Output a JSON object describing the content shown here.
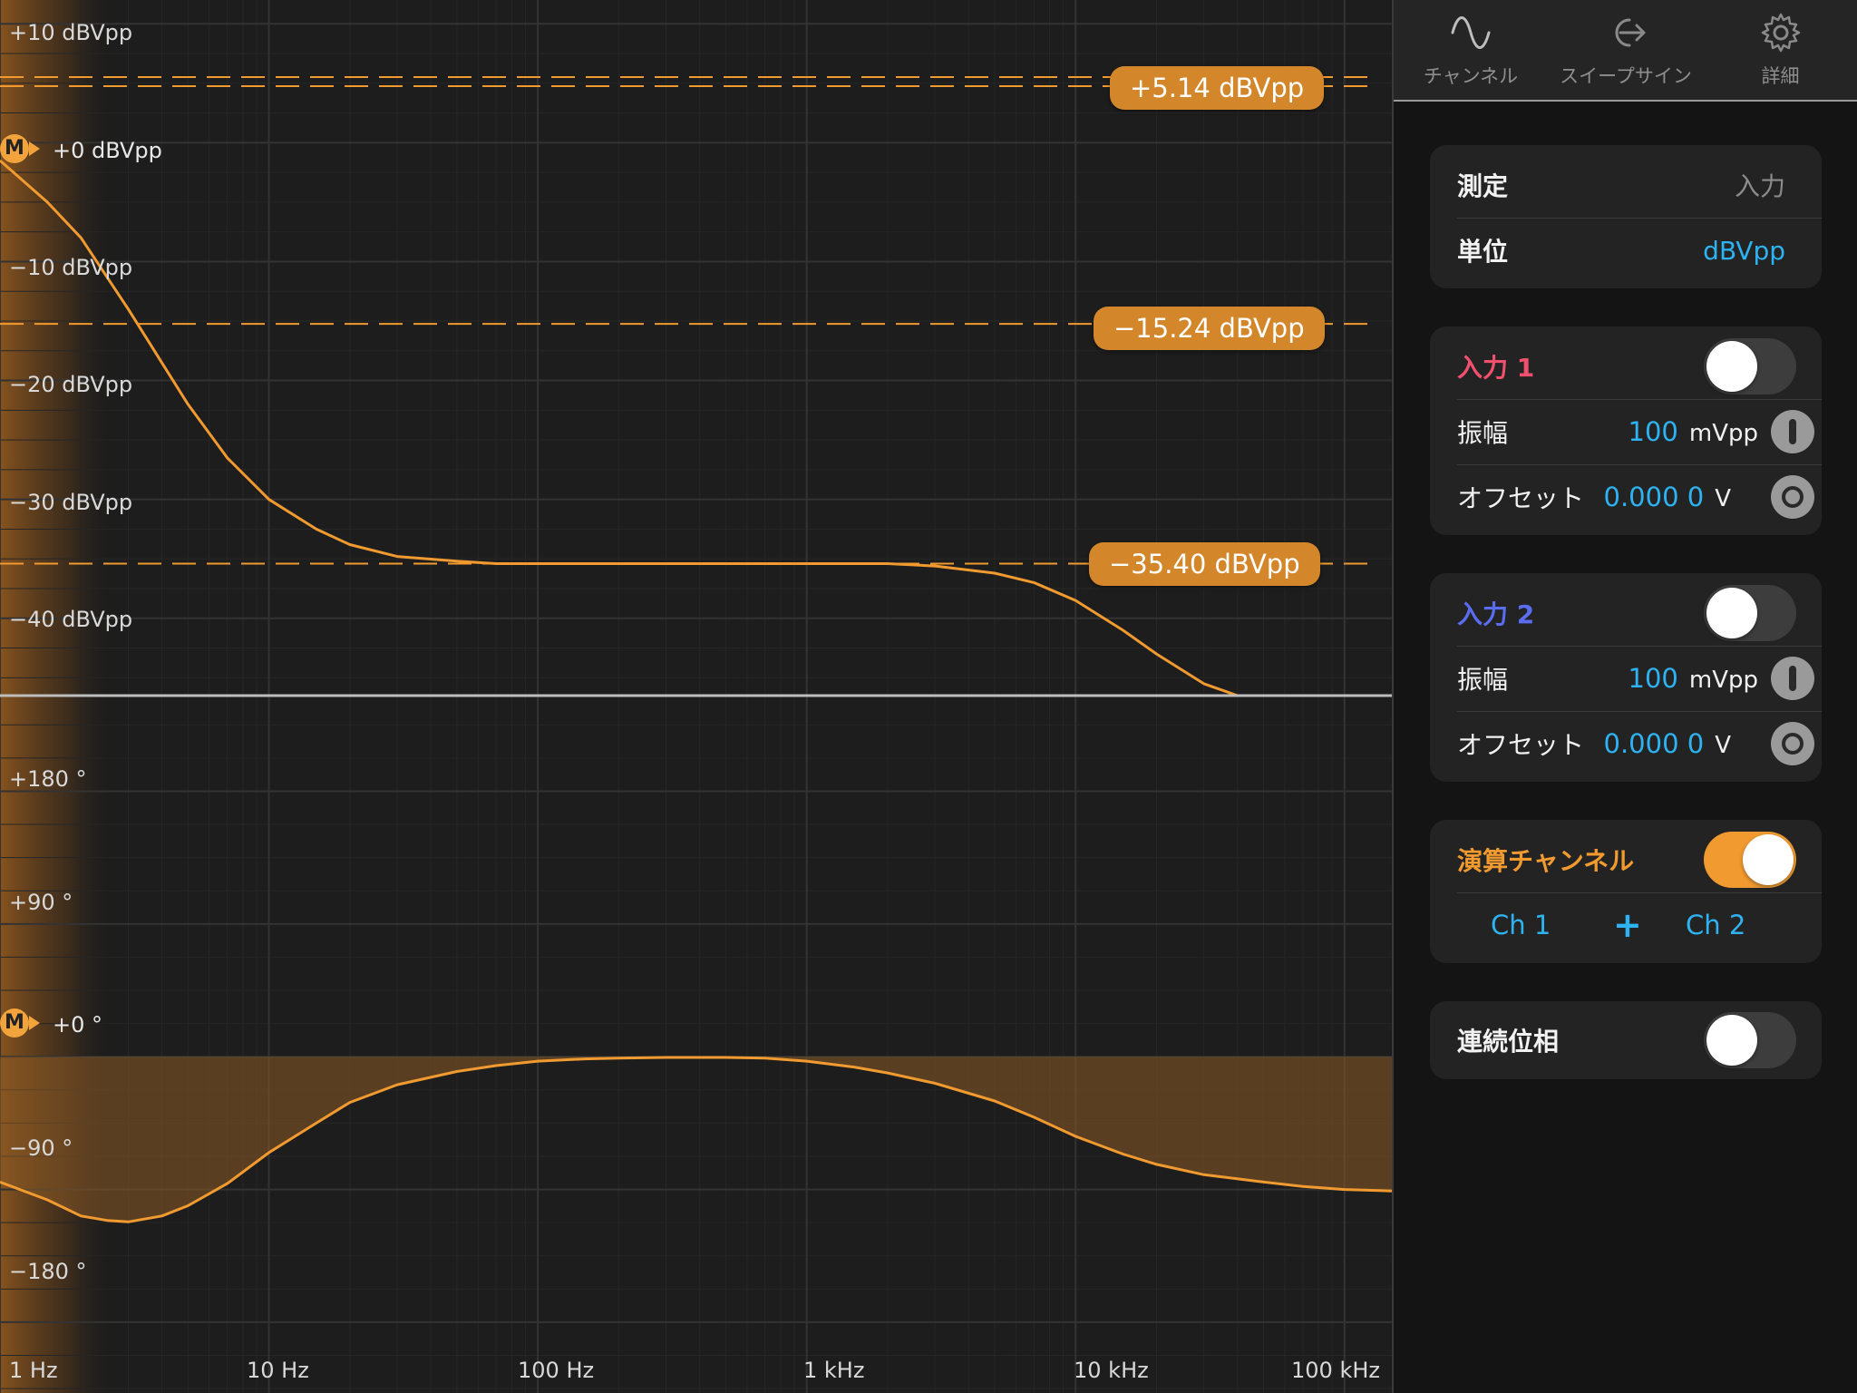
{
  "tabs": [
    {
      "label": "チャンネル",
      "icon": "sine-wave-icon",
      "active": true
    },
    {
      "label": "スイープサイン",
      "icon": "sweep-arrow-icon",
      "active": false
    },
    {
      "label": "詳細",
      "icon": "gear-icon",
      "active": false
    }
  ],
  "measurement_card": {
    "measure_label": "測定",
    "measure_value": "入力",
    "unit_label": "単位",
    "unit_value": "dBVpp"
  },
  "input1": {
    "title": "入力 1",
    "title_color": "#f0506e",
    "enabled": false,
    "amplitude_label": "振幅",
    "amplitude_value": "100",
    "amplitude_unit": "mVpp",
    "offset_label": "オフセット",
    "offset_value": "0.000 0",
    "offset_unit": "V"
  },
  "input2": {
    "title": "入力 2",
    "title_color": "#5a6cf0",
    "enabled": false,
    "amplitude_label": "振幅",
    "amplitude_value": "100",
    "amplitude_unit": "mVpp",
    "offset_label": "オフセット",
    "offset_value": "0.000 0",
    "offset_unit": "V"
  },
  "math_channel": {
    "title": "演算チャンネル",
    "title_color": "#f09a30",
    "enabled": true,
    "operand1": "Ch 1",
    "operator": "+",
    "operand2": "Ch 2"
  },
  "continuous_phase": {
    "label": "連続位相",
    "enabled": false
  },
  "plot": {
    "magnitude_markers": [
      "+5.14 dBVpp",
      "−15.24 dBVpp",
      "−35.40 dBVpp"
    ],
    "marker_badge": "M",
    "accent_color": "#f09a30"
  },
  "chart_data": [
    {
      "type": "line",
      "x_scale": "log",
      "xlim": [
        1,
        150000
      ],
      "x_ticks": [
        "1 Hz",
        "10 Hz",
        "100 Hz",
        "1 kHz",
        "10 kHz",
        "100 kHz"
      ],
      "y_ticks": [
        "+10 dBVpp",
        "+0 dBVpp",
        "−10 dBVpp",
        "−20 dBVpp",
        "−30 dBVpp",
        "−40 dBVpp"
      ],
      "ylim": [
        -46.5,
        12
      ],
      "reference_level": 0,
      "reference_label": "+0 dBVpp",
      "markers": [
        5.14,
        -15.24,
        -35.4
      ],
      "series": [
        {
          "x": [
            1,
            1.5,
            2,
            3,
            4,
            5,
            7,
            10,
            15,
            20,
            30,
            50,
            70,
            100,
            200,
            500,
            1000,
            2000,
            3000,
            5000,
            7000,
            10000,
            15000,
            20000,
            30000,
            40000
          ],
          "y": [
            -1.5,
            -5,
            -8,
            -14,
            -18.5,
            -22,
            -26.5,
            -30,
            -32.5,
            -33.8,
            -34.8,
            -35.2,
            -35.4,
            -35.4,
            -35.4,
            -35.4,
            -35.4,
            -35.4,
            -35.6,
            -36.2,
            -37,
            -38.5,
            -41,
            -43,
            -45.5,
            -47
          ]
        }
      ]
    },
    {
      "type": "area",
      "x_scale": "log",
      "xlim": [
        1,
        150000
      ],
      "x_ticks": [
        "1 Hz",
        "10 Hz",
        "100 Hz",
        "1 kHz",
        "10 kHz",
        "100 kHz"
      ],
      "y_ticks": [
        "+180 °",
        "+90 °",
        "+0 °",
        "−90 °",
        "−180 °"
      ],
      "ylim": [
        -228,
        243
      ],
      "reference_level": 0,
      "reference_label": "+0 °",
      "series": [
        {
          "x": [
            1,
            1.5,
            2,
            2.5,
            3,
            4,
            5,
            7,
            10,
            15,
            20,
            30,
            50,
            70,
            100,
            150,
            200,
            300,
            500,
            700,
            1000,
            1500,
            2000,
            3000,
            5000,
            7000,
            10000,
            15000,
            20000,
            30000,
            50000,
            70000,
            100000,
            150000
          ],
          "y": [
            -85,
            -97,
            -108,
            -111,
            -112,
            -108,
            -101,
            -86,
            -65,
            -45,
            -31,
            -19,
            -10,
            -6,
            -3,
            -1.5,
            -1,
            -0.5,
            -0.5,
            -1,
            -3,
            -7,
            -11,
            -18,
            -30,
            -41,
            -54,
            -66,
            -73,
            -80,
            -85,
            -88,
            -90,
            -91
          ]
        }
      ]
    }
  ]
}
